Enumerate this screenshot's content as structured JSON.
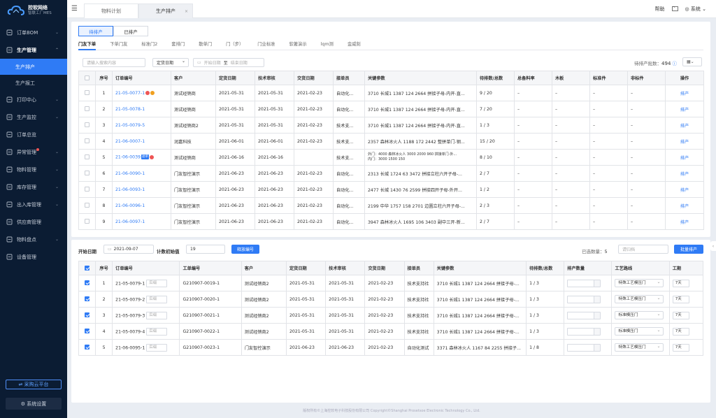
{
  "brand": {
    "name": "控软网络",
    "sub": "智联工厂MES"
  },
  "sidebar": {
    "items": [
      {
        "label": "订单BOM",
        "icon": "document-icon",
        "chev": "⌄"
      },
      {
        "label": "生产管理",
        "icon": "factory-icon",
        "chev": "⌃",
        "open": true,
        "children": [
          "生产排产",
          "生产报工"
        ]
      },
      {
        "label": "打印中心",
        "icon": "printer-icon",
        "chev": "⌄"
      },
      {
        "label": "生产监控",
        "icon": "monitor-icon",
        "chev": "⌄"
      },
      {
        "label": "订单总览",
        "icon": "overview-icon"
      },
      {
        "label": "异常管理",
        "icon": "alert-icon",
        "chev": "⌄",
        "dot": true
      },
      {
        "label": "物料管理",
        "icon": "box-icon",
        "chev": "⌄"
      },
      {
        "label": "库存管理",
        "icon": "warehouse-icon",
        "chev": "⌄"
      },
      {
        "label": "出入库管理",
        "icon": "inout-icon",
        "chev": "⌄"
      },
      {
        "label": "供应商管理",
        "icon": "supplier-icon"
      },
      {
        "label": "物料盘点",
        "icon": "inventory-icon",
        "chev": "⌄"
      },
      {
        "label": "设备管理",
        "icon": "device-icon"
      }
    ],
    "cloud": "⇌ 采购云平台",
    "settings": "⚙ 系统设置"
  },
  "topbar": {
    "menu_icon": "☰",
    "tabs": [
      "物料计划",
      "生产排产"
    ],
    "close": "×",
    "help": "帮助",
    "user": "系统"
  },
  "upper": {
    "status_tabs": [
      "待排产",
      "已排产"
    ],
    "subtabs": [
      "门友下单",
      "下单门友",
      "标准门2",
      "套排门",
      "散单门",
      "门（步）",
      "门业标准",
      "软著演示",
      "lqm测",
      "金威刻"
    ],
    "search_placeholder": "请输入搜索内容",
    "date_select": "定货日期",
    "date_start": "开始日期",
    "date_sep": "至",
    "date_end": "结束日期",
    "total_label": "待排产批数：",
    "total": "494",
    "columns": [
      "序号",
      "订单编号",
      "客户",
      "定货日期",
      "技术审核",
      "交货日期",
      "接单员",
      "关键参数",
      "待排数/总数",
      "总备料率",
      "木板",
      "标准件",
      "非标件",
      "操作"
    ],
    "rows": [
      [
        "1",
        "21-05-0077-1",
        "测试经销商",
        "2021-05-31",
        "2021-05-31",
        "2021-02-23",
        "自动化...",
        "3710 长城1 1387 124 2664 拼接子母-内开-直...",
        "9 / 20",
        "–",
        "–",
        "–",
        "–",
        "排产"
      ],
      [
        "2",
        "21-05-0078-1",
        "测试经销商",
        "2021-05-31",
        "2021-05-31",
        "2021-02-23",
        "自动化...",
        "3710 长城1 1387 124 2664 拼接子母-内开-直...",
        "7 / 20",
        "–",
        "–",
        "–",
        "–",
        "排产"
      ],
      [
        "3",
        "21-05-0079-5",
        "测试经销商2",
        "2021-05-31",
        "2021-05-31",
        "2021-02-23",
        "技术支...",
        "3710 长城1 1387 124 2664 拼接子母-内开-直...",
        "1 / 3",
        "–",
        "–",
        "–",
        "–",
        "排产"
      ],
      [
        "4",
        "21-06-0007-1",
        "润嘉科技",
        "2021-06-01",
        "2021-06-01",
        "2021-02-23",
        "技术支...",
        "2357 森林冰火人 1188 172 2442 整拼单门-钢...",
        "15 / 20",
        "–",
        "–",
        "–",
        "–",
        "排产"
      ],
      [
        "5",
        "21-06-0039",
        "测试经销商",
        "2021-06-16",
        "2021-06-16",
        "",
        "技术支...",
        "外门：4000 森林冰火人 3000 2000 960 拼接单门-外...|内门：3000 1500 150",
        "8 / 10",
        "–",
        "–",
        "–",
        "–",
        "排产"
      ],
      [
        "6",
        "21-06-0090-1",
        "门友智控演示",
        "2021-06-23",
        "2021-06-23",
        "2021-02-23",
        "自动化...",
        "2313 长城 1724 63 3472 拼接立柱六开子母-...",
        "2 / 7",
        "–",
        "–",
        "–",
        "–",
        "排产"
      ],
      [
        "7",
        "21-06-0093-1",
        "门友智控演示",
        "2021-06-23",
        "2021-06-23",
        "2021-02-23",
        "自动化...",
        "2477 长城 1430 76 2599 拼接四开子母-外开...",
        "1 / 2",
        "–",
        "–",
        "–",
        "–",
        "排产"
      ],
      [
        "8",
        "21-06-0096-1",
        "门友智控演示",
        "2021-06-23",
        "2021-06-23",
        "2021-02-23",
        "自动化...",
        "2199 中华 1757 158 2701 边圆立柱六开子母-...",
        "2 / 3",
        "–",
        "–",
        "–",
        "–",
        "排产"
      ],
      [
        "9",
        "21-06-0097-1",
        "门友智控演示",
        "2021-06-23",
        "2021-06-23",
        "2021-02-23",
        "自动化...",
        "3947 森林冰火人 1695 106 3403 副中三开-新...",
        "2 / 7",
        "–",
        "–",
        "–",
        "–",
        "排产"
      ]
    ],
    "tag5": "退单"
  },
  "lower": {
    "start_label": "开始日期",
    "start_value": "2021-09-07",
    "count_label": "计数初始值",
    "count_value": "19",
    "gen_btn": "释放编号",
    "selected_label": "已选数量：",
    "selected": "5",
    "release_placeholder": "请归档",
    "batch_btn": "批量排产",
    "columns": [
      "序号",
      "订单编号",
      "工单编号",
      "客户",
      "定货日期",
      "技术审核",
      "交货日期",
      "接单员",
      "关键参数",
      "待排数/总数",
      "排产数量",
      "工艺路线",
      "工期"
    ],
    "rows": [
      [
        "1",
        "21-05-0079-1",
        "G210907-0019-1",
        "测试经销商2",
        "2021-05-31",
        "2021-05-31",
        "2021-02-23",
        "技术支持社",
        "3710 长城1 1387 124 2664 拼接子母-...",
        "1 / 3",
        "特殊工艺模压门",
        "7天"
      ],
      [
        "2",
        "21-05-0079-2",
        "G210907-0020-1",
        "测试经销商2",
        "2021-05-31",
        "2021-05-31",
        "2021-02-23",
        "技术支持社",
        "3710 长城1 1387 124 2664 拼接子母-...",
        "1 / 3",
        "特殊工艺模压门",
        "7天"
      ],
      [
        "3",
        "21-05-0079-3",
        "G210907-0021-1",
        "测试经销商2",
        "2021-05-31",
        "2021-05-31",
        "2021-02-23",
        "技术支持社",
        "3710 长城1 1387 124 2664 拼接子母-...",
        "1 / 3",
        "标准模压门",
        "7天"
      ],
      [
        "4",
        "21-05-0079-4",
        "G210907-0022-1",
        "测试经销商2",
        "2021-05-31",
        "2021-05-31",
        "2021-02-23",
        "技术支持社",
        "3710 长城1 1387 124 2664 拼接子母-...",
        "1 / 3",
        "标准模压门",
        "7天"
      ],
      [
        "5",
        "21-06-0095-1",
        "G210907-0023-1",
        "门友智控演示",
        "2021-06-23",
        "2021-06-23",
        "2021-02-23",
        "自动化测试",
        "3371 森林冰火人 1167 84 2255 拼接子...",
        "1 / 8",
        "特殊工艺模压门",
        "7天"
      ]
    ],
    "remark_placeholder": "后缀"
  },
  "footer": "版权所有©上海控软电子科技股份有限公司 Copyright©Shanghai Prosetsoe Electronic Technology Co., Ltd."
}
